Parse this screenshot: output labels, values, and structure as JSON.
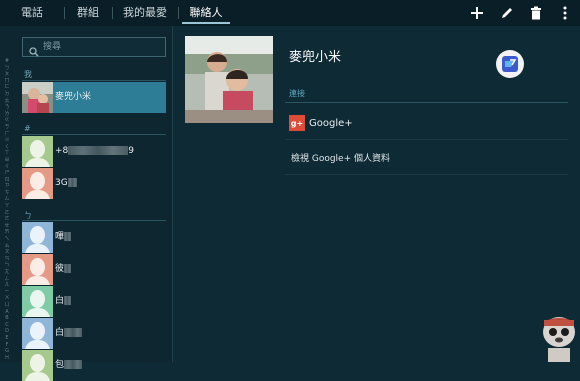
{
  "tabs": [
    {
      "label": "電話"
    },
    {
      "label": "群組"
    },
    {
      "label": "我的最愛"
    },
    {
      "label": "聯絡人"
    }
  ],
  "toolbar": {
    "add_icon": "plus-icon",
    "edit_icon": "pencil-icon",
    "delete_icon": "trash-icon",
    "more_icon": "overflow-menu-icon"
  },
  "search": {
    "placeholder": "搜尋"
  },
  "index_letters": [
    "#",
    "ㄅ",
    "ㄆ",
    "ㄇ",
    "ㄈ",
    "ㄉ",
    "ㄊ",
    "ㄋ",
    "ㄌ",
    "ㄍ",
    "ㄎ",
    "ㄏ",
    "ㄐ",
    "ㄑ",
    "ㄒ",
    "ㄓ",
    "ㄔ",
    "ㄕ",
    "ㄖ",
    "ㄗ",
    "ㄘ",
    "ㄙ",
    "ㄚ",
    "ㄛ",
    "ㄜ",
    "ㄝ",
    "ㄞ",
    "ㄟ",
    "ㄠ",
    "ㄡ",
    "ㄢ",
    "ㄣ",
    "ㄤ",
    "ㄥ",
    "ㄦ",
    "ㄧ",
    "ㄨ",
    "ㄩ",
    "A",
    "B",
    "C",
    "D",
    "E",
    "F",
    "G",
    "H"
  ],
  "sections": {
    "me": "我",
    "hash": "#",
    "bo": "ㄅ"
  },
  "contacts": {
    "me": {
      "name": "麥兜小米"
    },
    "c1": {
      "name_prefix": "+8",
      "name_suffix": "9"
    },
    "c2": {
      "name_prefix": "3G"
    },
    "c3": {
      "name_prefix": "嗶"
    },
    "c4": {
      "name_prefix": "彼"
    },
    "c5": {
      "name_prefix": "白"
    },
    "c6": {
      "name_prefix": "白"
    },
    "c7": {
      "name_prefix": "包"
    }
  },
  "detail": {
    "name": "麥兜小米",
    "connections_label": "連接",
    "google_plus": "Google+",
    "google_plus_icon_text": "g+",
    "view_profile": "檢視 Google+ 個人資料"
  },
  "colors": {
    "accent": "#2c7d95",
    "background": "#0e2a35",
    "gplus_red": "#dd4b39"
  }
}
